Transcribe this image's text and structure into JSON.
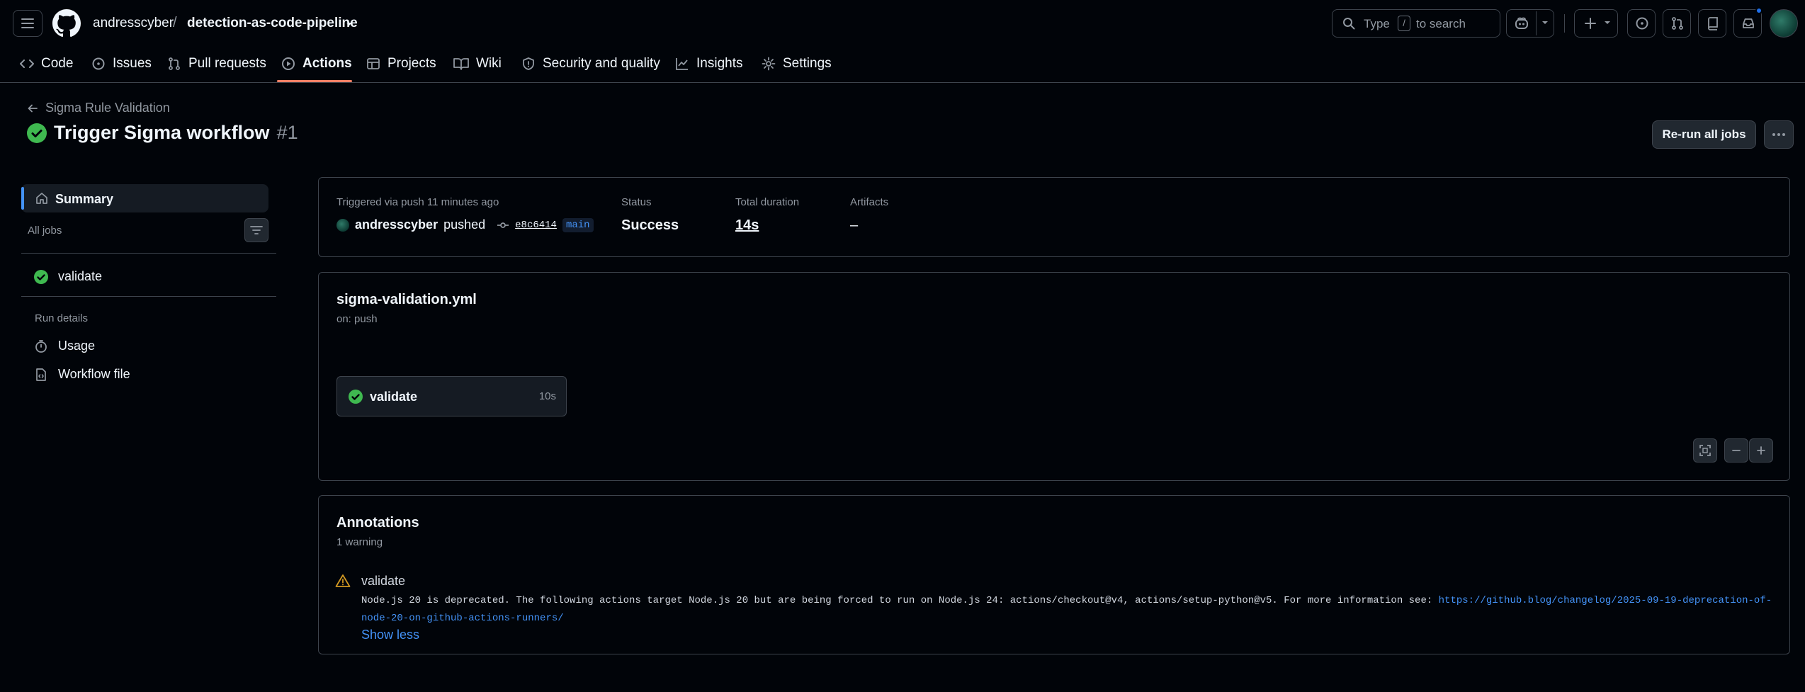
{
  "header": {
    "owner": "andresscyber",
    "separator": "/",
    "repo": "detection-as-code-pipeline",
    "search_prefix": "Type",
    "search_key": "/",
    "search_suffix": "to search"
  },
  "tabs": [
    {
      "label": "Code",
      "icon": "code-icon"
    },
    {
      "label": "Issues",
      "icon": "issue-icon"
    },
    {
      "label": "Pull requests",
      "icon": "pull-request-icon"
    },
    {
      "label": "Actions",
      "icon": "play-icon",
      "active": true
    },
    {
      "label": "Projects",
      "icon": "table-icon"
    },
    {
      "label": "Wiki",
      "icon": "book-icon"
    },
    {
      "label": "Security and quality",
      "icon": "shield-icon"
    },
    {
      "label": "Insights",
      "icon": "graph-icon"
    },
    {
      "label": "Settings",
      "icon": "gear-icon"
    }
  ],
  "run": {
    "back_label": "Sigma Rule Validation",
    "title": "Trigger Sigma workflow",
    "number": "#1",
    "rerun_label": "Re-run all jobs"
  },
  "sidebar": {
    "summary": "Summary",
    "all_jobs": "All jobs",
    "jobs": [
      {
        "label": "validate",
        "status": "success"
      }
    ],
    "run_details": "Run details",
    "details_items": [
      {
        "label": "Usage",
        "icon": "stopwatch-icon"
      },
      {
        "label": "Workflow file",
        "icon": "file-code-icon"
      }
    ]
  },
  "summary": {
    "triggered": "Triggered via push 11 minutes ago",
    "actor": "andresscyber",
    "action": "pushed",
    "sha": "e8c6414",
    "branch": "main",
    "status_label": "Status",
    "status_value": "Success",
    "duration_label": "Total duration",
    "duration_value": "14s",
    "artifacts_label": "Artifacts",
    "artifacts_value": "–"
  },
  "workflow": {
    "file": "sigma-validation.yml",
    "on": "on: push",
    "job": {
      "label": "validate",
      "duration": "10s"
    }
  },
  "annotations": {
    "title": "Annotations",
    "count": "1 warning",
    "items": [
      {
        "job": "validate",
        "message": "Node.js 20 is deprecated. The following actions target Node.js 20 but are being forced to run on Node.js 24: actions/checkout@v4, actions/setup-python@v5. For more information see: ",
        "link": "https://github.blog/changelog/2025-09-19-deprecation-of-node-20-on-github-actions-runners/"
      }
    ],
    "toggle": "Show less"
  },
  "colors": {
    "accent": "#4493f8",
    "success": "#3fb950",
    "warning": "#d29922",
    "tab_underline": "#f78166"
  }
}
